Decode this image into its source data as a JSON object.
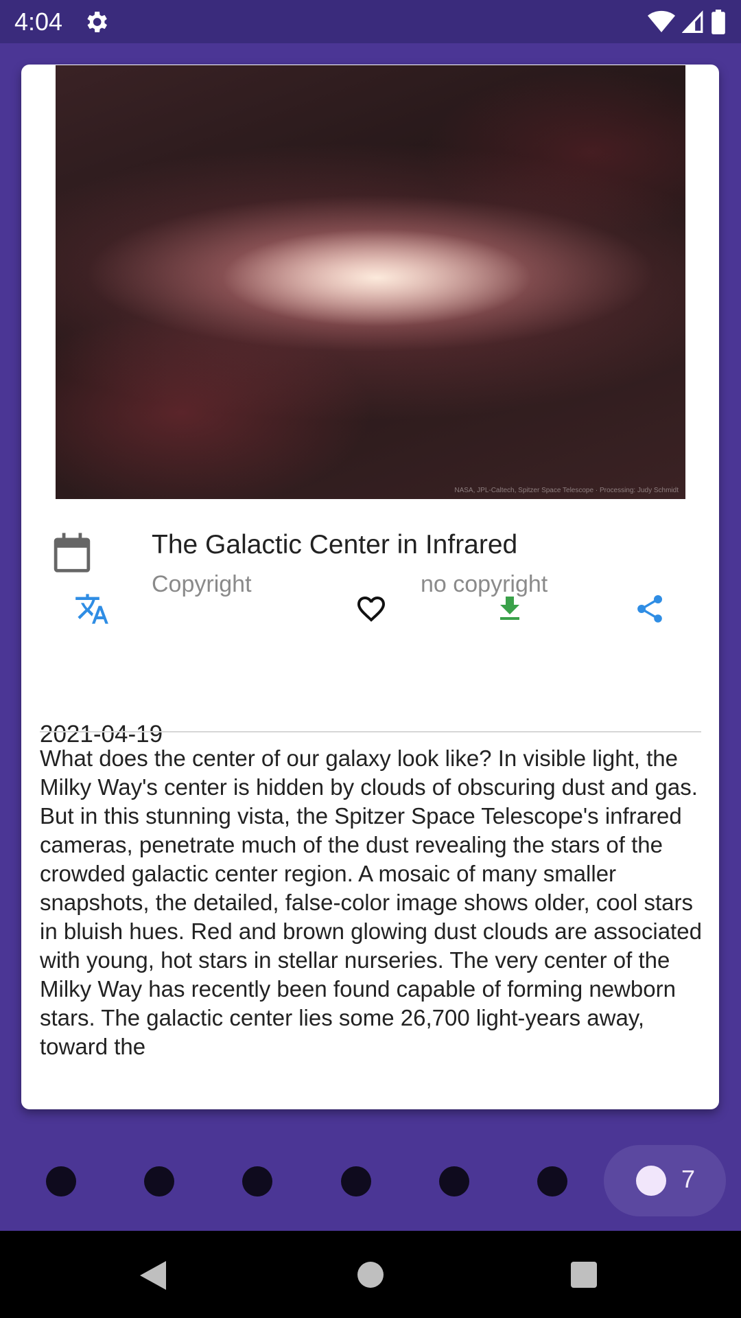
{
  "status": {
    "time": "4:04",
    "icons": [
      "settings-icon",
      "wifi-icon",
      "cell-signal-icon",
      "battery-icon"
    ]
  },
  "apod": {
    "image_credit": "NASA, JPL-Caltech, Spitzer Space Telescope · Processing: Judy Schmidt",
    "title": "The Galactic Center in Infrared",
    "copyright_label": "Copyright",
    "copyright_value": "no copyright",
    "date": "2021-04-19",
    "explanation": "What does the center of our galaxy look like?  In visible light, the Milky Way's center is hidden by clouds of obscuring dust and gas. But in this stunning vista, the Spitzer Space Telescope's infrared cameras, penetrate much of the dust revealing the stars of the crowded galactic center region. A mosaic of many smaller snapshots, the detailed, false-color image shows older, cool stars in bluish hues. Red and brown glowing dust clouds are associated with young, hot stars in stellar nurseries. The very center of the Milky Way has recently been found capable of forming newborn stars. The galactic center lies some 26,700 light-years away, toward the"
  },
  "actions": {
    "translate_icon": "translate-icon",
    "favorite_icon": "heart-outline-icon",
    "download_icon": "download-icon",
    "share_icon": "share-icon",
    "translate_color": "#2f8de4",
    "download_color": "#3aa14a",
    "share_color": "#2f8de4"
  },
  "pager": {
    "total_dots": 7,
    "current_page": "7"
  },
  "colors": {
    "background": "#4b3695",
    "status_bar": "#3a2b7c",
    "card": "#ffffff",
    "pager_active": "#5b48a0"
  }
}
